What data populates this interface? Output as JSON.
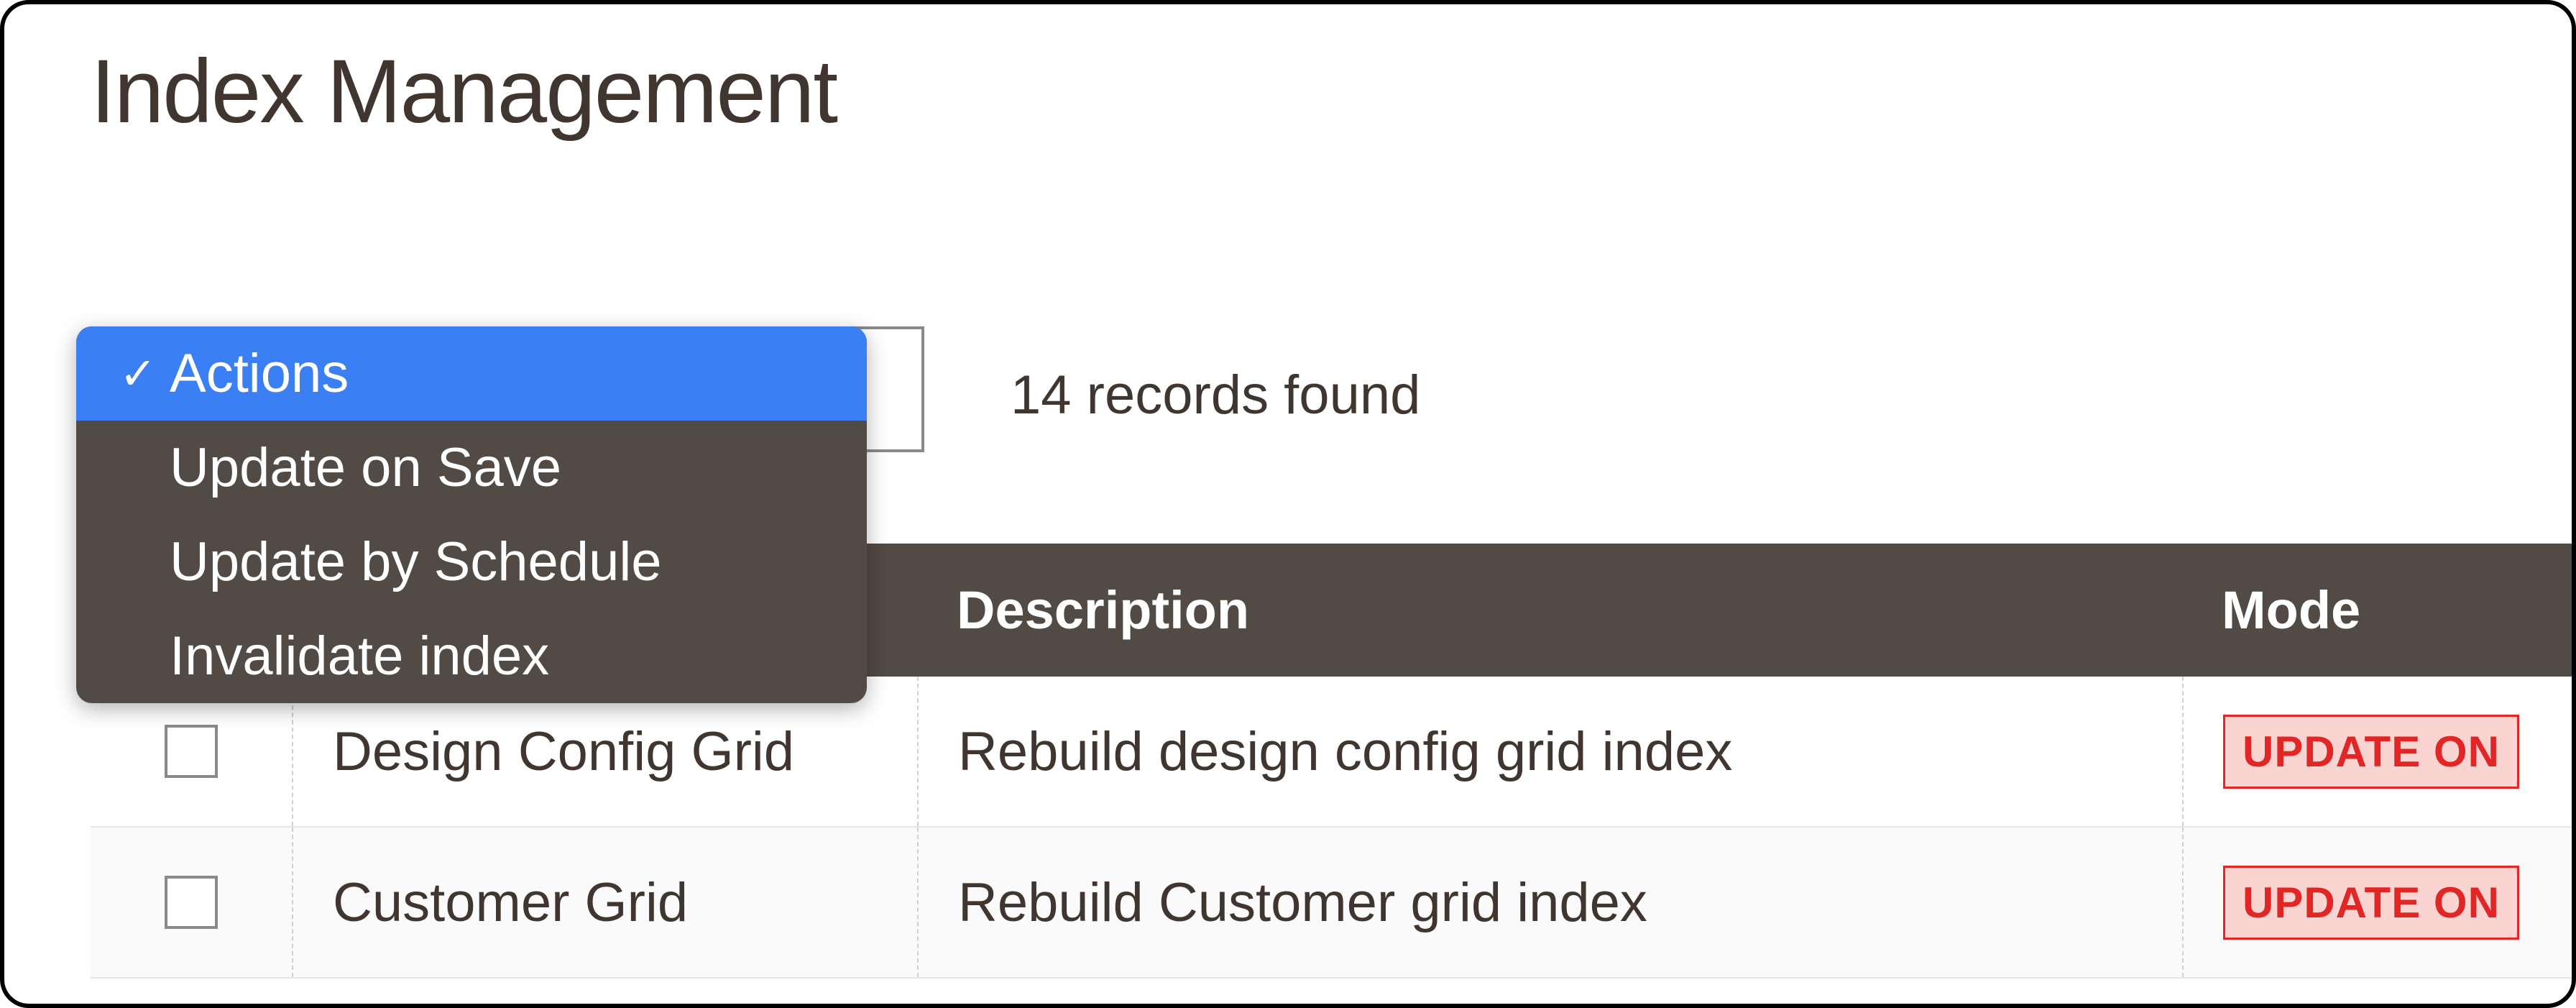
{
  "page": {
    "title": "Index Management"
  },
  "toolbar": {
    "records_found": "14 records found"
  },
  "actions_dropdown": {
    "items": [
      {
        "label": "Actions",
        "selected": true
      },
      {
        "label": "Update on Save",
        "selected": false
      },
      {
        "label": "Update by Schedule",
        "selected": false
      },
      {
        "label": "Invalidate index",
        "selected": false
      }
    ]
  },
  "table": {
    "headers": {
      "description": "Description",
      "mode": "Mode"
    },
    "rows": [
      {
        "indexer": "Design Config Grid",
        "description": "Rebuild design config grid index",
        "mode": "UPDATE ON"
      },
      {
        "indexer": "Customer Grid",
        "description": "Rebuild Customer grid index",
        "mode": "UPDATE ON"
      }
    ]
  },
  "colors": {
    "header_bg": "#524a45",
    "accent_blue": "#3b7ff5",
    "badge_text": "#e22626",
    "badge_bg": "#f9d4d1"
  }
}
